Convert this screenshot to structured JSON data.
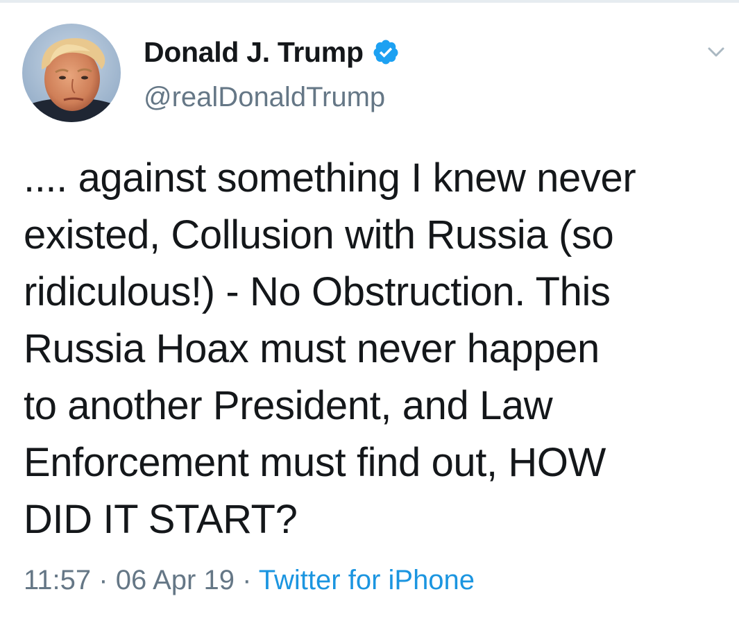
{
  "user": {
    "display_name": "Donald J. Trump",
    "handle": "@realDonaldTrump",
    "verified": true
  },
  "tweet": {
    "text_lines": [
      ".... against something I knew never",
      "existed, Collusion with Russia (so",
      "ridiculous!) - No Obstruction. This",
      "Russia Hoax must never happen",
      "to another President, and Law",
      "Enforcement must find out, HOW",
      "DID IT START?"
    ]
  },
  "meta": {
    "time": "11:57",
    "separator": "·",
    "date": "06 Apr 19",
    "source": "Twitter for iPhone"
  },
  "icons": {
    "verified": "verified-badge-icon",
    "more": "chevron-down-icon"
  },
  "colors": {
    "text": "#14171a",
    "secondary": "#657786",
    "link": "#1b95e0",
    "verified": "#1da1f2"
  }
}
